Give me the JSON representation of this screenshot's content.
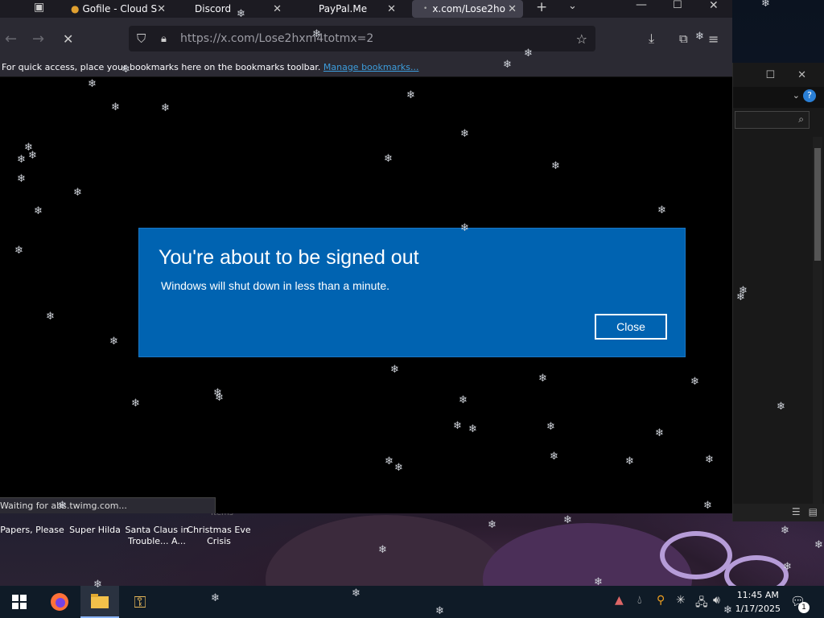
{
  "browser": {
    "tabs": [
      {
        "label": "Gofile - Cloud S",
        "active": false
      },
      {
        "label": "Discord",
        "active": false
      },
      {
        "label": "PayPal.Me",
        "active": false
      },
      {
        "label": "x.com/Lose2ho",
        "active": true
      }
    ],
    "url": "https://x.com/Lose2hxm4totmx=2",
    "bookmarks_text": "For quick access, place your bookmarks here on the bookmarks toolbar.",
    "bookmarks_link": "Manage bookmarks...",
    "status": "Waiting for abs.twimg.com..."
  },
  "dialog": {
    "title": "You're about to be signed out",
    "message": "Windows will shut down in less than a minute.",
    "close_label": "Close"
  },
  "desktop_icons": [
    {
      "label": "Papers, Please"
    },
    {
      "label": "Super Hilda"
    },
    {
      "label": "Santa Claus in Trouble... A..."
    },
    {
      "label": "Christmas Eve Crisis"
    }
  ],
  "desktop_partial": {
    "items_label": "Items"
  },
  "taskbar": {
    "time": "11:45 AM",
    "date": "1/17/2025",
    "notification_count": "1"
  },
  "colors": {
    "dialog_bg": "#0063b1",
    "browser_chrome": "#2b2a33",
    "link": "#3d9ddc"
  }
}
